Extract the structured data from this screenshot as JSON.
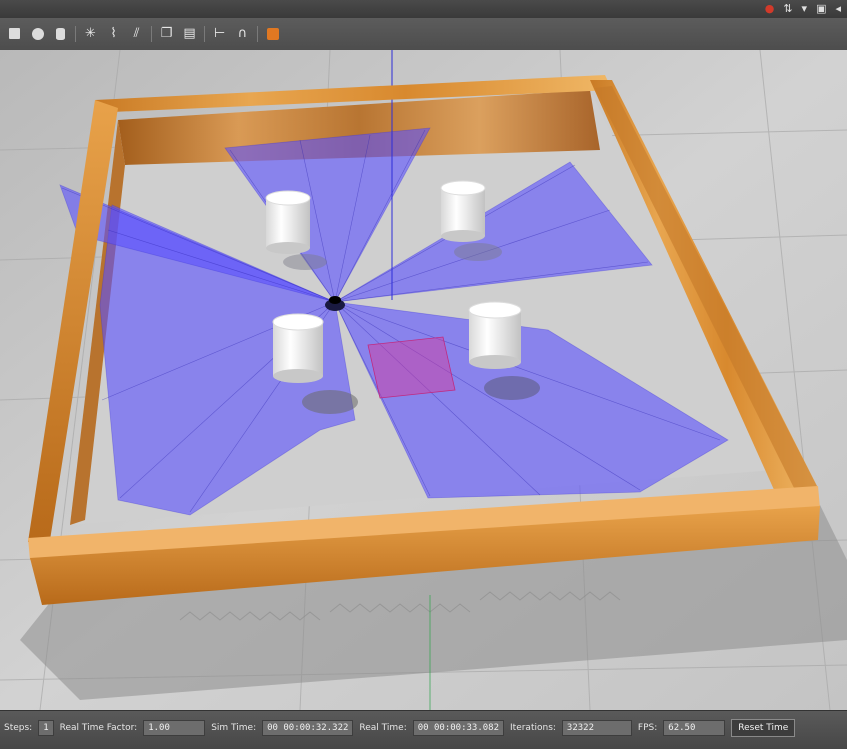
{
  "toolbar": {
    "icons": [
      "select-arrow-icon",
      "translate-icon",
      "rotate-icon",
      "scale-icon",
      "box-shape-icon",
      "sphere-shape-icon",
      "cylinder-shape-icon",
      "point-light-icon",
      "spot-light-icon",
      "directional-light-icon",
      "copy-icon",
      "paste-icon",
      "align-icon",
      "snap-icon",
      "record-icon"
    ]
  },
  "tray": {
    "icons": [
      "record-indicator-icon",
      "network-icon",
      "wifi-icon",
      "keyboard-icon",
      "volume-icon"
    ]
  },
  "status": {
    "steps_label": "Steps:",
    "steps_value": "1",
    "rtf_label": "Real Time Factor:",
    "rtf_value": "1.00",
    "sim_time_label": "Sim Time:",
    "sim_time_value": "00 00:00:32.322",
    "real_time_label": "Real Time:",
    "real_time_value": "00 00:00:33.082",
    "iterations_label": "Iterations:",
    "iterations_value": "32322",
    "fps_label": "FPS:",
    "fps_value": "62.50",
    "reset_label": "Reset Time"
  },
  "scene": {
    "wall_color": "#d8892e",
    "laser_color": "#5a50ff",
    "cylinder_count": 4
  }
}
